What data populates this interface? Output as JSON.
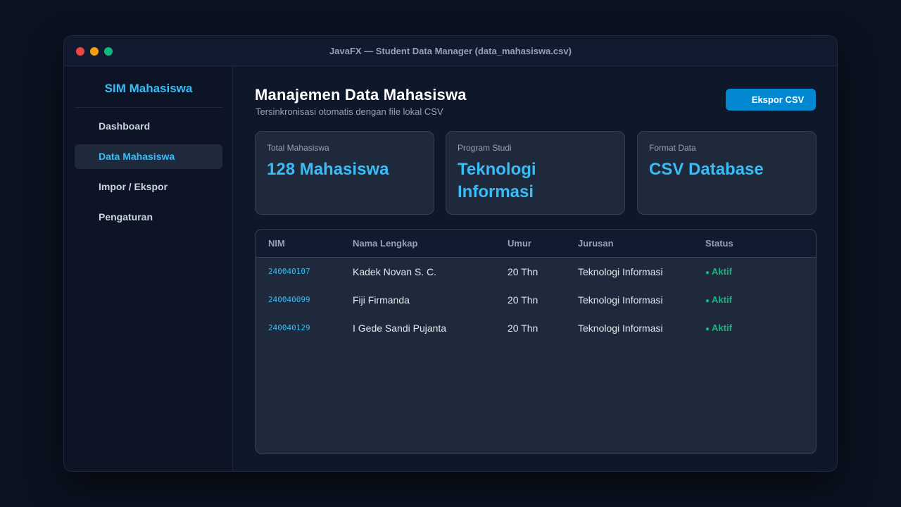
{
  "window": {
    "title": "JavaFX — Student Data Manager (data_mahasiswa.csv)"
  },
  "sidebar": {
    "brand": "SIM Mahasiswa",
    "items": [
      {
        "label": "Dashboard",
        "active": false
      },
      {
        "label": "Data Mahasiswa",
        "active": true
      },
      {
        "label": "Impor / Ekspor",
        "active": false
      },
      {
        "label": "Pengaturan",
        "active": false
      }
    ]
  },
  "main": {
    "title": "Manajemen Data Mahasiswa",
    "subtitle": "Tersinkronisasi otomatis dengan file lokal CSV",
    "export_label": "Ekspor CSV",
    "cards": [
      {
        "label": "Total Mahasiswa",
        "value": "128 Mahasiswa"
      },
      {
        "label": "Program Studi",
        "value": "Teknologi Informasi"
      },
      {
        "label": "Format Data",
        "value": "CSV Database"
      }
    ],
    "table": {
      "headers": [
        "NIM",
        "Nama Lengkap",
        "Umur",
        "Jurusan",
        "Status"
      ],
      "status_dot": "●",
      "rows": [
        {
          "nim": "240040107",
          "nama": "Kadek Novan S. C.",
          "umur": "20 Thn",
          "jurusan": "Teknologi Informasi",
          "status": "Aktif"
        },
        {
          "nim": "240040099",
          "nama": "Fiji Firmanda",
          "umur": "20 Thn",
          "jurusan": "Teknologi Informasi",
          "status": "Aktif"
        },
        {
          "nim": "240040129",
          "nama": "I Gede Sandi Pujanta",
          "umur": "20 Thn",
          "jurusan": "Teknologi Informasi",
          "status": "Aktif"
        }
      ]
    }
  },
  "colors": {
    "accent": "#38bdf8",
    "button": "#0288d1",
    "status_active": "#10b981",
    "background": "#0f172a",
    "card": "#1e293b"
  }
}
